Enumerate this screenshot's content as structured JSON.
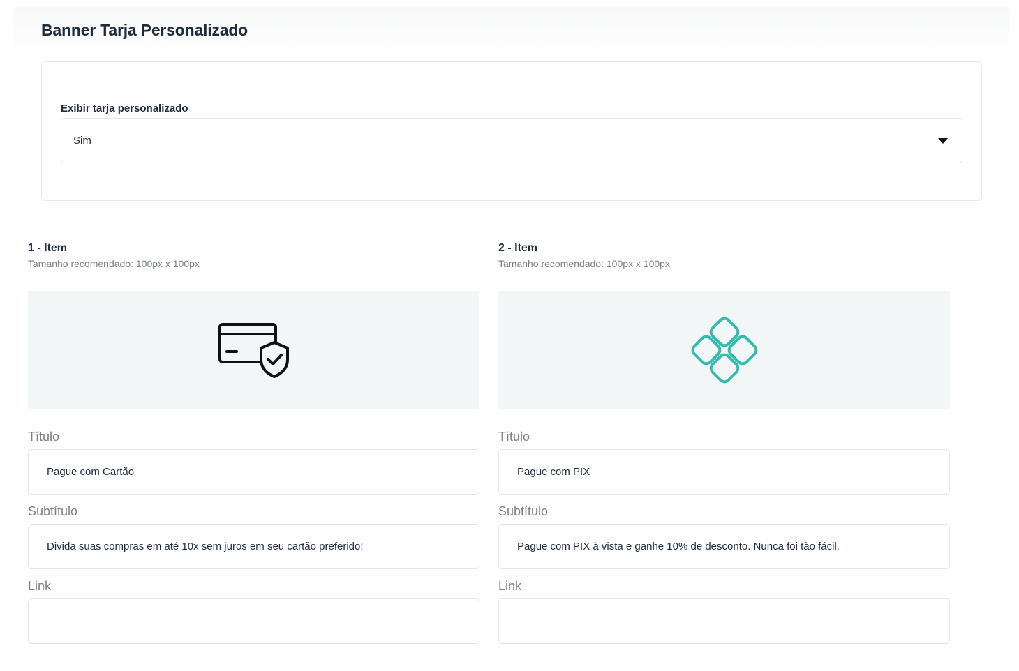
{
  "page": {
    "title": "Banner Tarja Personalizado"
  },
  "display": {
    "label": "Exibir tarja personalizado",
    "selected": "Sim"
  },
  "items": [
    {
      "heading": "1 - Item",
      "hint": "Tamanho recomendado: 100px x 100px",
      "image_icon": "credit-card-shield-icon",
      "title_label": "Título",
      "title_value": "Pague com Cartão",
      "subtitle_label": "Subtítulo",
      "subtitle_value": "Divida suas compras em até 10x sem juros em seu cartão preferido!",
      "link_label": "Link",
      "link_value": ""
    },
    {
      "heading": "2 - Item",
      "hint": "Tamanho recomendado: 100px x 100px",
      "image_icon": "pix-logo-icon",
      "title_label": "Título",
      "title_value": "Pague com PIX",
      "subtitle_label": "Subtítulo",
      "subtitle_value": "Pague com PIX à vista e ganhe 10% de desconto. Nunca foi tão fácil.",
      "link_label": "Link",
      "link_value": ""
    }
  ],
  "colors": {
    "pix_teal": "#32bcad",
    "image_bg": "#f3f6f6"
  }
}
